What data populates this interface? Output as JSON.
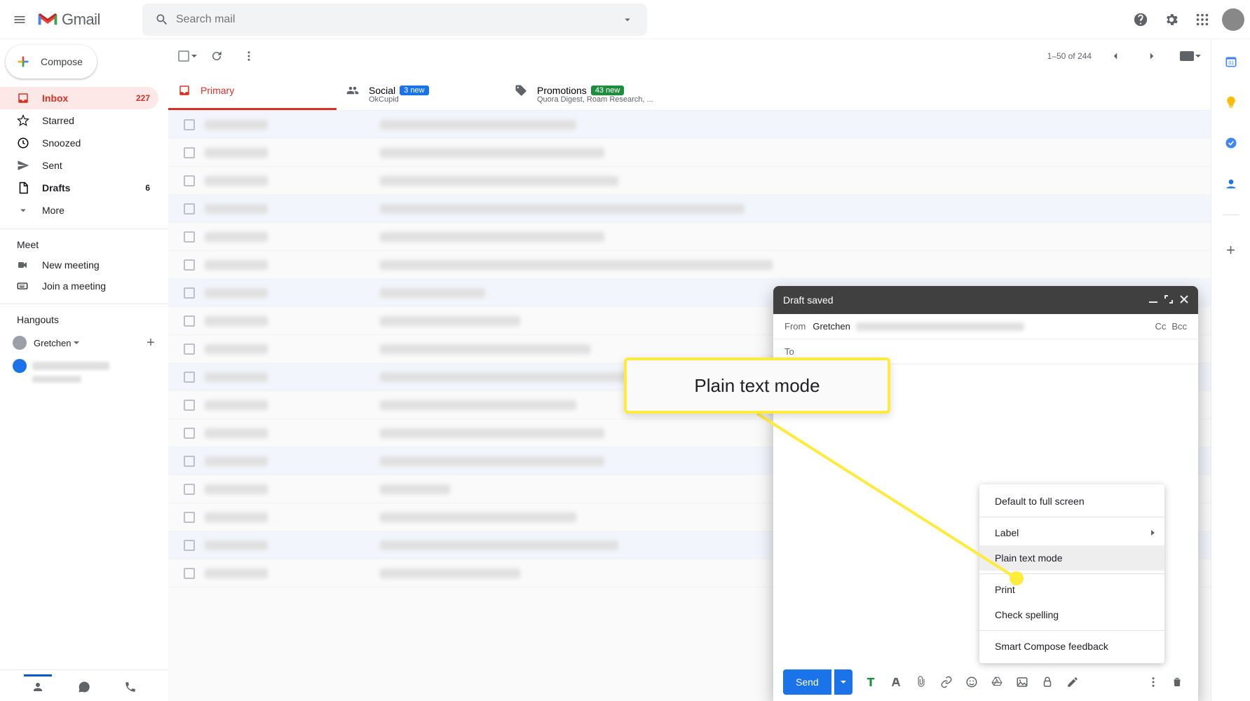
{
  "header": {
    "search_placeholder": "Search mail",
    "gmail_word": "Gmail"
  },
  "sidebar": {
    "compose_label": "Compose",
    "nav": [
      {
        "label": "Inbox",
        "count": "227",
        "icon": "inbox",
        "active": true,
        "bold": true
      },
      {
        "label": "Starred",
        "count": "",
        "icon": "star"
      },
      {
        "label": "Snoozed",
        "count": "",
        "icon": "clock"
      },
      {
        "label": "Sent",
        "count": "",
        "icon": "send"
      },
      {
        "label": "Drafts",
        "count": "6",
        "icon": "draft",
        "bold": true
      },
      {
        "label": "More",
        "count": "",
        "icon": "chevron-down"
      }
    ],
    "meet_heading": "Meet",
    "meet_links": [
      {
        "label": "New meeting",
        "icon": "video"
      },
      {
        "label": "Join a meeting",
        "icon": "keyboard"
      }
    ],
    "hangouts_heading": "Hangouts",
    "hangouts_user": "Gretchen"
  },
  "toolbar": {
    "pagination": "1–50 of 244"
  },
  "tabs": [
    {
      "label": "Primary",
      "badge": "",
      "badge_color": "",
      "sub": ""
    },
    {
      "label": "Social",
      "badge": "3 new",
      "badge_color": "#1a73e8",
      "sub": "OkCupid"
    },
    {
      "label": "Promotions",
      "badge": "43 new",
      "badge_color": "#1e8e3e",
      "sub": "Quora Digest, Roam Research, ..."
    }
  ],
  "compose_window": {
    "title": "Draft saved",
    "from_label": "From",
    "from_name": "Gretchen",
    "to_label": "To",
    "cc_label": "Cc",
    "bcc_label": "Bcc",
    "send_label": "Send"
  },
  "context_menu": [
    {
      "label": "Default to full screen",
      "type": "item"
    },
    {
      "type": "sep"
    },
    {
      "label": "Label",
      "type": "submenu"
    },
    {
      "label": "Plain text mode",
      "type": "item",
      "highlight": true
    },
    {
      "type": "sep"
    },
    {
      "label": "Print",
      "type": "item"
    },
    {
      "label": "Check spelling",
      "type": "item"
    },
    {
      "type": "sep"
    },
    {
      "label": "Smart Compose feedback",
      "type": "item"
    }
  ],
  "callout_text": "Plain text mode",
  "colors": {
    "primary_red": "#d93025",
    "blue": "#1a73e8",
    "green": "#1e8e3e",
    "highlight": "#ffeb3b"
  }
}
